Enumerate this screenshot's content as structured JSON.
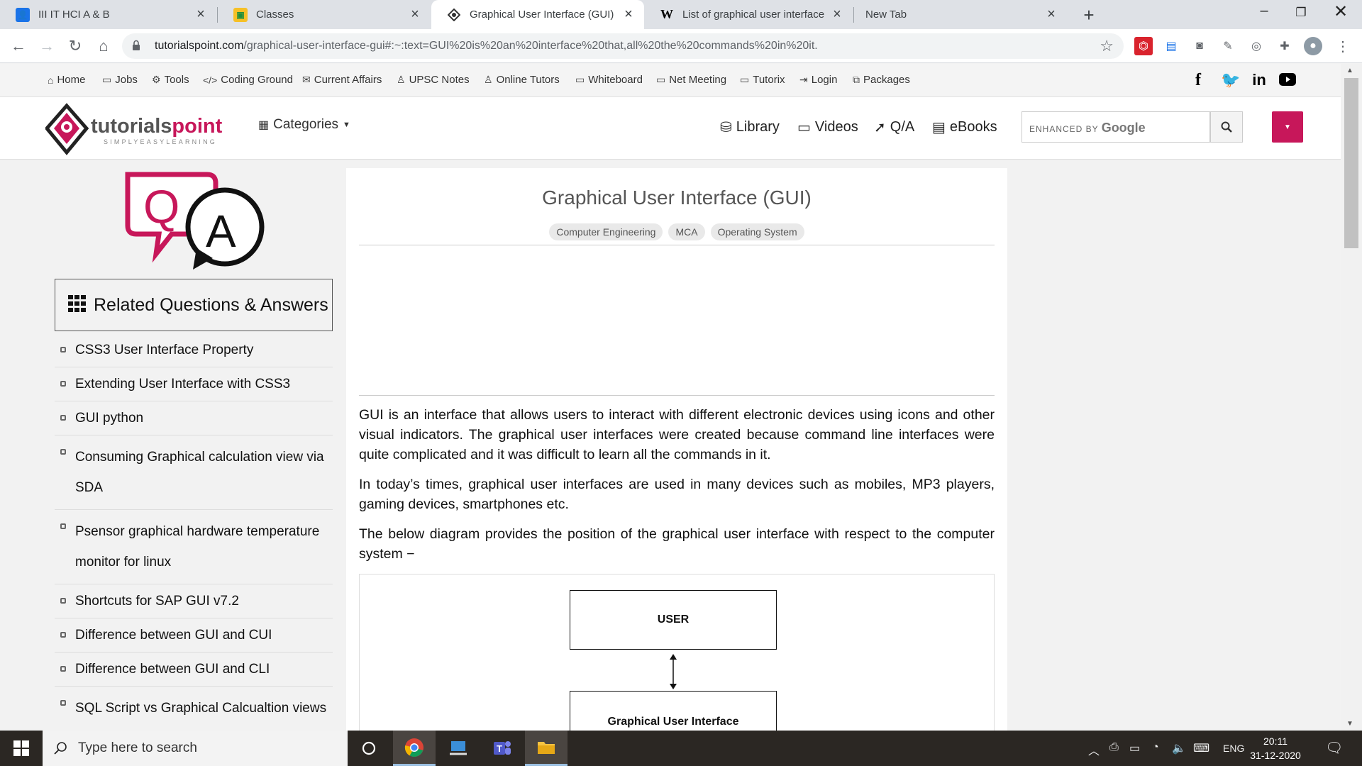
{
  "browser": {
    "tabs": [
      {
        "title": "III IT HCI A & B",
        "active": false
      },
      {
        "title": "Classes",
        "active": false
      },
      {
        "title": "Graphical User Interface (GUI)",
        "active": true
      },
      {
        "title": "List of graphical user interface el",
        "active": false
      },
      {
        "title": "New Tab",
        "active": false
      }
    ],
    "url_host": "tutorialspoint.com",
    "url_rest": "/graphical-user-interface-gui#:~:text=GUI%20is%20an%20interface%20that,all%20the%20commands%20in%20it."
  },
  "site_nav": {
    "items": [
      "Home",
      "Jobs",
      "Tools",
      "Coding Ground",
      "Current Affairs",
      "UPSC Notes",
      "Online Tutors",
      "Whiteboard",
      "Net Meeting",
      "Tutorix",
      "Login",
      "Packages"
    ]
  },
  "header": {
    "logo_text": "tutorialspoint",
    "logo_tagline": "SIMPLYEASYLEARNING",
    "categories": "Categories",
    "links": [
      "Library",
      "Videos",
      "Q/A",
      "eBooks"
    ],
    "search_enhanced": "ENHANCED BY",
    "search_brand": "Google"
  },
  "sidebar": {
    "related_title": "Related Questions & Answers",
    "related": [
      "CSS3 User Interface Property",
      "Extending User Interface with CSS3",
      "GUI python",
      "Consuming Graphical calculation view via SDA",
      "Psensor graphical hardware temperature monitor for linux",
      "Shortcuts for SAP GUI v7.2",
      "Difference between GUI and CUI",
      "Difference between GUI and CLI",
      "SQL Script vs Graphical Calcualtion views in SAP HANA"
    ]
  },
  "article": {
    "title": "Graphical User Interface (GUI)",
    "tags": [
      "Computer Engineering",
      "MCA",
      "Operating System"
    ],
    "paragraphs": [
      "GUI is an interface that allows users to interact with different electronic devices using icons and other visual indicators. The graphical user interfaces were created because command line interfaces were quite complicated and it was difficult to learn all the commands in it.",
      "In today’s times, graphical user interfaces are used in many devices such as mobiles, MP3 players, gaming devices, smartphones etc.",
      "The below diagram provides the position of the graphical user interface with respect to the computer system −"
    ],
    "diagram": {
      "box1": "USER",
      "box2": "Graphical User Interface"
    }
  },
  "taskbar": {
    "search_placeholder": "Type here to search",
    "lang": "ENG",
    "time": "20:11",
    "date": "31-12-2020"
  },
  "colors": {
    "brand": "#c7175a",
    "accent": "#1a73e8"
  }
}
